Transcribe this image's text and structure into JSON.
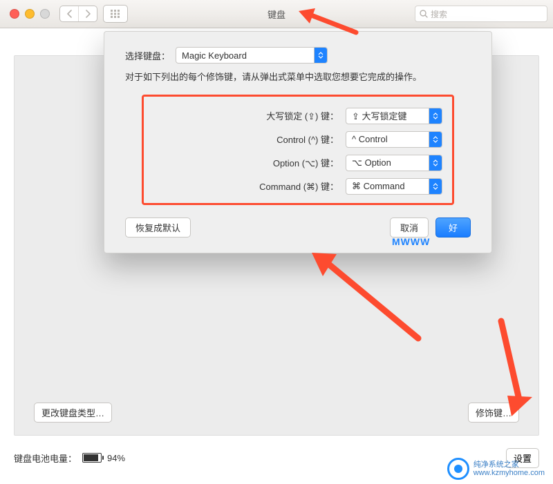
{
  "window": {
    "title": "键盘"
  },
  "toolbar": {
    "back_icon": "chevron-left",
    "fwd_icon": "chevron-right",
    "grid_icon": "grid",
    "search_placeholder": "搜索"
  },
  "sheet": {
    "select_keyboard_label": "选择键盘：",
    "select_keyboard_value": "Magic Keyboard",
    "description": "对于如下列出的每个修饰键，请从弹出式菜单中选取您想要它完成的操作。",
    "modifiers": [
      {
        "label": "大写锁定 (⇪) 键：",
        "value": "⇪ 大写锁定键"
      },
      {
        "label": "Control (^) 键：",
        "value": "^ Control"
      },
      {
        "label": "Option (⌥) 键：",
        "value": "⌥ Option"
      },
      {
        "label": "Command (⌘) 键：",
        "value": "⌘ Command"
      }
    ],
    "restore_defaults": "恢复成默认",
    "cancel": "取消",
    "ok": "好"
  },
  "panel": {
    "change_keyboard_type": "更改键盘类型…",
    "modifier_keys": "修饰键…"
  },
  "footer": {
    "battery_label": "键盘电池电量：",
    "battery_percent": "94%",
    "setup_bluetooth": "设置"
  },
  "watermark": {
    "overlay_on_ok": "MWWW",
    "line1": "纯净系统之家",
    "line2": "www.kzmyhome.com"
  }
}
